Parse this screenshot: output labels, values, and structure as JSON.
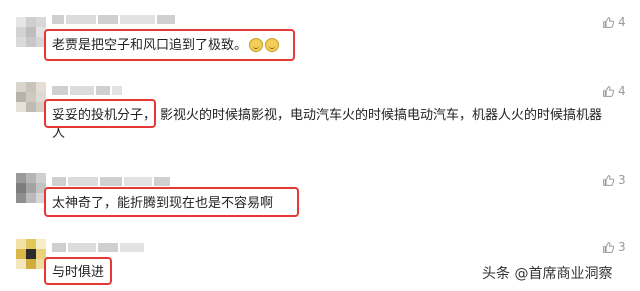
{
  "comments": [
    {
      "text": "老贾是把空子和风口追到了极致。",
      "likes": "4"
    },
    {
      "text_highlight": "妥妥的投机分子，",
      "text_rest_1": "影视火的时候搞影视，电动汽车火的时候搞电动汽车，机器人火的时候搞机器",
      "text_rest_2": "人",
      "likes": "4"
    },
    {
      "text": "太神奇了，能折腾到现在也是不容易啊",
      "likes": "3"
    },
    {
      "text": "与时俱进",
      "likes": "3"
    }
  ],
  "watermark": "头条 @首席商业洞察",
  "colors": {
    "highlight_border": "#e53935",
    "like_gray": "#9a9a9a"
  }
}
